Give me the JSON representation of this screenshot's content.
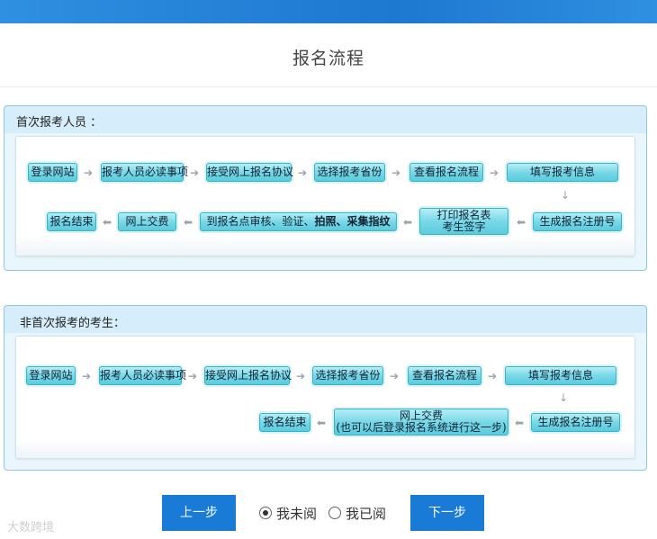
{
  "page_title": "报名流程",
  "first_time": {
    "heading": "首次报考人员 ：",
    "row1": [
      "登录网站",
      "报考人员必读事项",
      "接受网上报名协议",
      "选择报考省份",
      "查看报名流程",
      "填写报考信息"
    ],
    "row2": {
      "register_no": "生成报名注册号",
      "print_line1": "打印报名表",
      "print_line2": "考生签字",
      "site_audit_prefix": "到报名点审核、验证、",
      "site_audit_bold": "拍照、采集指纹",
      "pay": "网上交费",
      "end": "报名结束"
    }
  },
  "non_first_time": {
    "heading": "非首次报考的考生：",
    "row1": [
      "登录网站",
      "报考人员必读事项",
      "接受网上报名协议",
      "选择报考省份",
      "查看报名流程",
      "填写报考信息"
    ],
    "row2": {
      "register_no": "生成报名注册号",
      "pay_line1": "网上交费",
      "pay_line2": "(也可以后登录报名系统进行这一步)",
      "end": "报名结束"
    }
  },
  "controls": {
    "prev_label": "上一步",
    "unread_label": "我未阅",
    "read_label": "我已阅",
    "selected": "我未阅",
    "next_label": "下一步"
  },
  "watermark": "大数跨境"
}
